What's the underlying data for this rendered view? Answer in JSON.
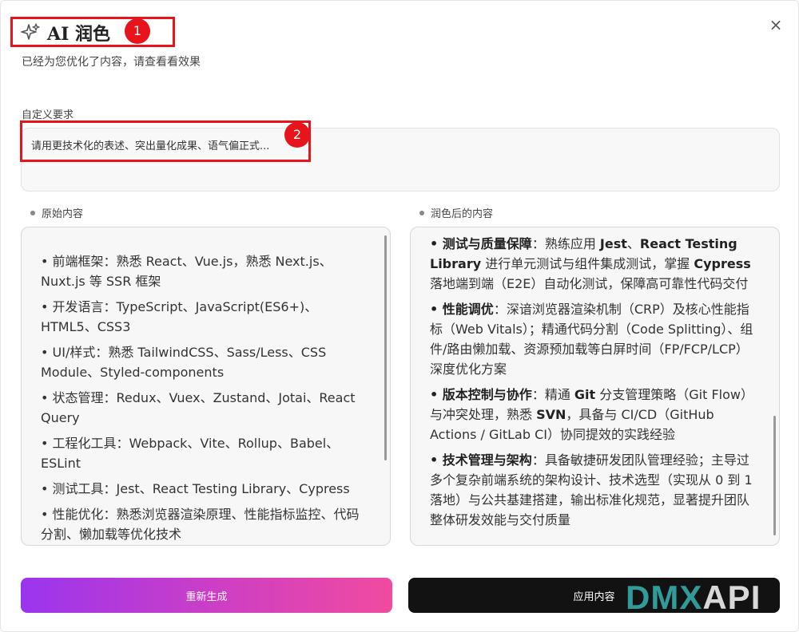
{
  "dialog": {
    "title": "AI 润色",
    "subtitle": "已经为您优化了内容，请查看看效果",
    "close_label": "×"
  },
  "annotations": [
    "1",
    "2"
  ],
  "custom_requirement": {
    "label": "自定义要求",
    "value": "请用更技术化的表述、突出量化成果、语气偏正式..."
  },
  "original": {
    "label": "原始内容",
    "items": [
      "• 前端框架：熟悉 React、Vue.js，熟悉 Next.js、Nuxt.js 等 SSR 框架",
      "• 开发语言：TypeScript、JavaScript(ES6+)、HTML5、CSS3",
      "• UI/样式：熟悉 TailwindCSS、Sass/Less、CSS Module、Styled-components",
      "• 状态管理：Redux、Vuex、Zustand、Jotai、React Query",
      "• 工程化工具：Webpack、Vite、Rollup、Babel、ESLint",
      "• 测试工具：Jest、React Testing Library、Cypress",
      "• 性能优化：熟悉浏览器渲染原理、性能指标监控、代码分割、懒加载等优化技术"
    ]
  },
  "polished": {
    "label": "润色后的内容",
    "items": [
      {
        "head": "• 测试与质量保障",
        "segments": [
          {
            "t": "：熟练应用 ",
            "b": false
          },
          {
            "t": "Jest",
            "b": true
          },
          {
            "t": "、",
            "b": false
          },
          {
            "t": "React Testing Library",
            "b": true
          },
          {
            "t": " 进行单元测试与组件集成测试，掌握 ",
            "b": false
          },
          {
            "t": "Cypress",
            "b": true
          },
          {
            "t": " 落地端到端（E2E）自动化测试，保障高可靠性代码交付",
            "b": false
          }
        ]
      },
      {
        "head": "• 性能调优",
        "segments": [
          {
            "t": "：深谙浏览器渲染机制（CRP）及核心性能指标（Web Vitals）；精通代码分割（Code Splitting）、组件/路由懒加载、资源预加载等白屏时间（FP/FCP/LCP）深度优化方案",
            "b": false
          }
        ]
      },
      {
        "head": "• 版本控制与协作",
        "segments": [
          {
            "t": "：精通 ",
            "b": false
          },
          {
            "t": "Git",
            "b": true
          },
          {
            "t": " 分支管理策略（Git Flow）与冲突处理，熟悉 ",
            "b": false
          },
          {
            "t": "SVN",
            "b": true
          },
          {
            "t": "，具备与 CI/CD（GitHub Actions / GitLab CI）协同提效的实践经验",
            "b": false
          }
        ]
      },
      {
        "head": "• 技术管理与架构",
        "segments": [
          {
            "t": "：具备敏捷研发团队管理经验；主导过多个复杂前端系统的架构设计、技术选型（实现从 0 到 1 落地）与公共基建搭建，输出标准化规范，显著提升团队整体研发效能与交付质量",
            "b": false
          }
        ]
      }
    ]
  },
  "buttons": {
    "regenerate": "重新生成",
    "apply": "应用内容"
  },
  "watermark": {
    "part_a": "DMX",
    "part_b": "API"
  },
  "icons": {
    "title_icon": "sparkle-icon",
    "close_icon": "close-icon"
  }
}
